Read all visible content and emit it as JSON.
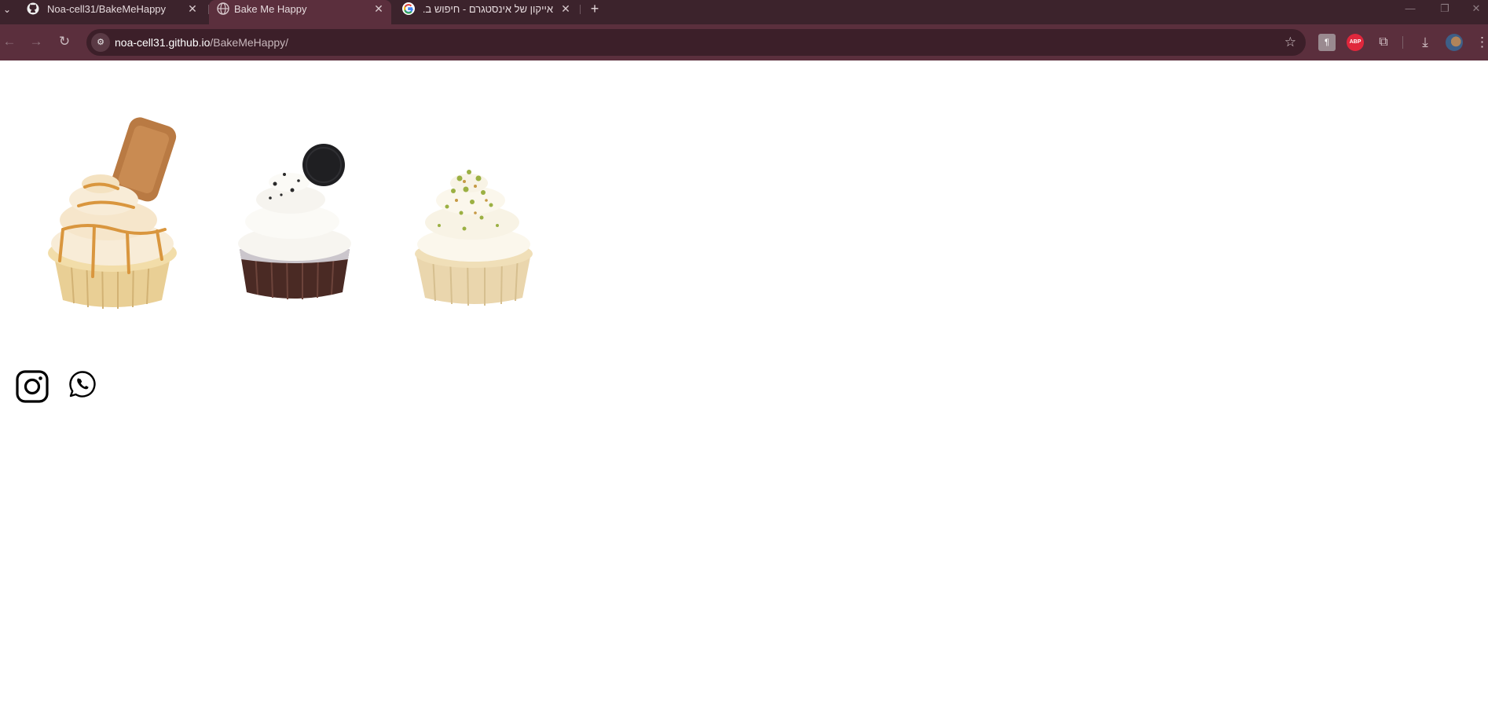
{
  "browser": {
    "tabs": [
      {
        "title": "Noa-cell31/BakeMeHappy",
        "favicon": "github-icon",
        "active": false
      },
      {
        "title": "Bake Me Happy",
        "favicon": "globe-icon",
        "active": true
      },
      {
        "title": "אייקון של אינסטגרם - חיפוש ב...",
        "favicon": "google-icon",
        "active": false
      }
    ],
    "new_tab_label": "+",
    "url_host": "noa-cell31.github.io",
    "url_path": "/BakeMeHappy/"
  },
  "page": {
    "cupcakes": [
      {
        "name": "lotus-cupcake",
        "topping": "biscuit"
      },
      {
        "name": "oreo-cupcake",
        "topping": "cookie"
      },
      {
        "name": "pistachio-cupcake",
        "topping": "pistachio"
      }
    ],
    "social_links": [
      {
        "name": "instagram-icon"
      },
      {
        "name": "whatsapp-icon"
      }
    ]
  },
  "colors": {
    "tabstrip": "#3c232c",
    "toolbar": "#5b2f3d",
    "omnibox": "#3c1f29",
    "page_bg": "#ffffff"
  }
}
